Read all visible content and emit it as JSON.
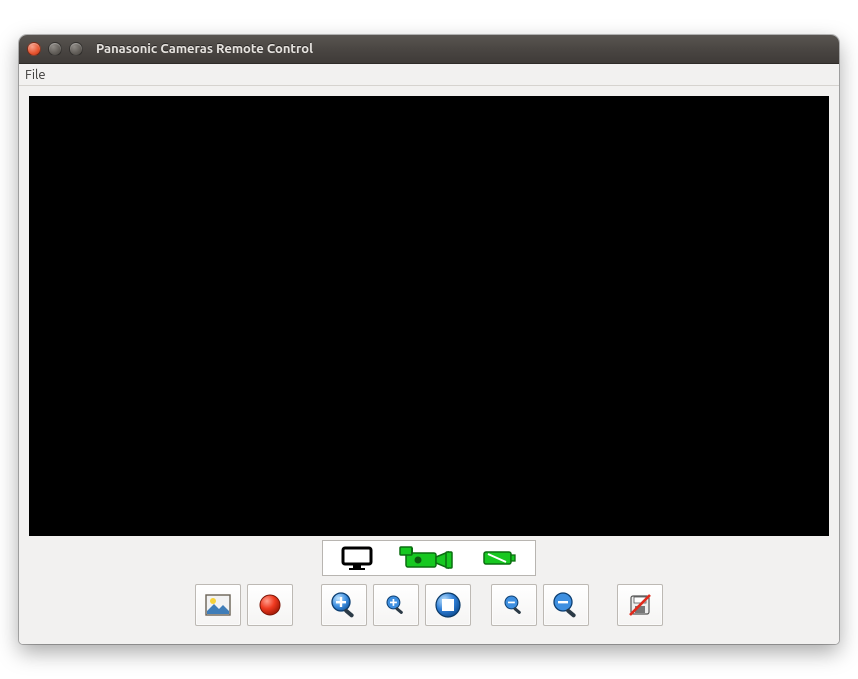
{
  "window": {
    "title": "Panasonic Cameras Remote Control"
  },
  "menubar": {
    "items": [
      "File"
    ]
  },
  "mode_strip": {
    "monitor_label": "monitor-mode",
    "camcorder_label": "camcorder-mode",
    "battery_label": "battery-status"
  },
  "toolbar": {
    "buttons": [
      {
        "name": "capture-image-button"
      },
      {
        "name": "record-button"
      },
      {
        "name": "zoom-in-button"
      },
      {
        "name": "zoom-in-more-button"
      },
      {
        "name": "zoom-fit-button"
      },
      {
        "name": "zoom-out-more-button"
      },
      {
        "name": "zoom-out-button"
      },
      {
        "name": "stop-disable-button"
      }
    ]
  }
}
